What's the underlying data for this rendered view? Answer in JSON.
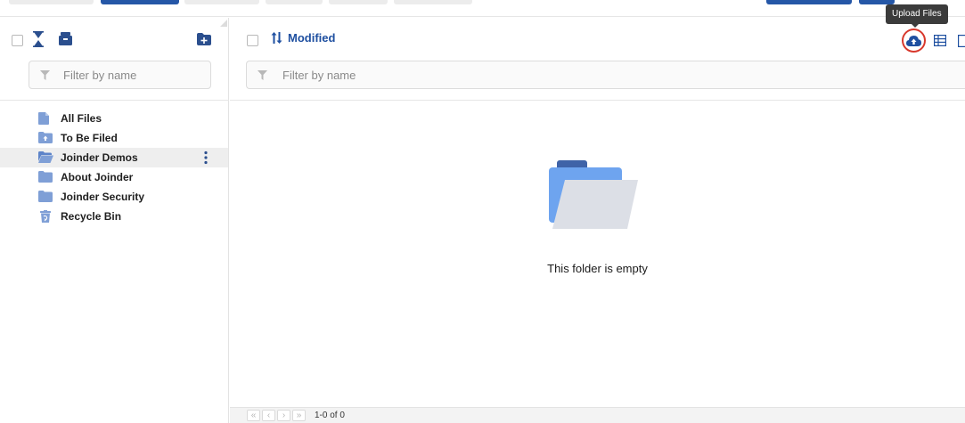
{
  "sidebar": {
    "filter_placeholder": "Filter by name",
    "items": [
      {
        "label": "All Files",
        "icon": "file-icon"
      },
      {
        "label": "To Be Filed",
        "icon": "upload-folder-icon"
      },
      {
        "label": "Joinder Demos",
        "icon": "open-folder-icon",
        "selected": true
      },
      {
        "label": "About Joinder",
        "icon": "folder-icon"
      },
      {
        "label": "Joinder Security",
        "icon": "folder-icon"
      },
      {
        "label": "Recycle Bin",
        "icon": "recycle-bin-icon"
      }
    ]
  },
  "main": {
    "sort_label": "Modified",
    "filter_placeholder": "Filter by name",
    "upload_tooltip": "Upload Files",
    "empty_message": "This folder is empty",
    "pagination": {
      "count_text": "1-0 of 0",
      "first": "«",
      "prev": "‹",
      "next": "›",
      "last": "»"
    }
  },
  "colors": {
    "accent": "#1e4fa0",
    "folder_blue": "#7f9fd6",
    "highlight_ring": "#d8382c",
    "selected_row": "#eeeeee"
  }
}
